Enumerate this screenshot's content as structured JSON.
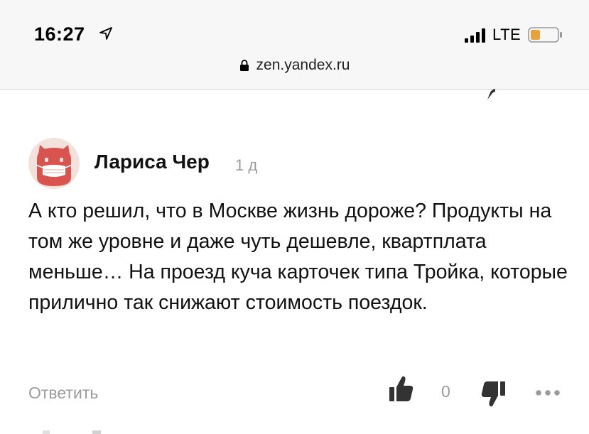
{
  "status_bar": {
    "time": "16:27",
    "network": "LTE",
    "icons": [
      "location-arrow-icon",
      "signal-icon",
      "battery-icon"
    ]
  },
  "browser": {
    "url": "zen.yandex.ru"
  },
  "comment": {
    "author": "Лариса Чер",
    "age": "1 д",
    "text": "А кто решил, что в Москве жизнь дороже? Продукты на том же уровне и даже чуть дешевле, квартплата меньше… На проезд куча карточек типа Тройка, которые прилично так снижают стоимость поездок.",
    "reply_label": "Ответить",
    "like_count": "0"
  },
  "colors": {
    "avatar_red": "#d9534f",
    "muted": "#9b9b9b",
    "icon_dark": "#333333"
  }
}
